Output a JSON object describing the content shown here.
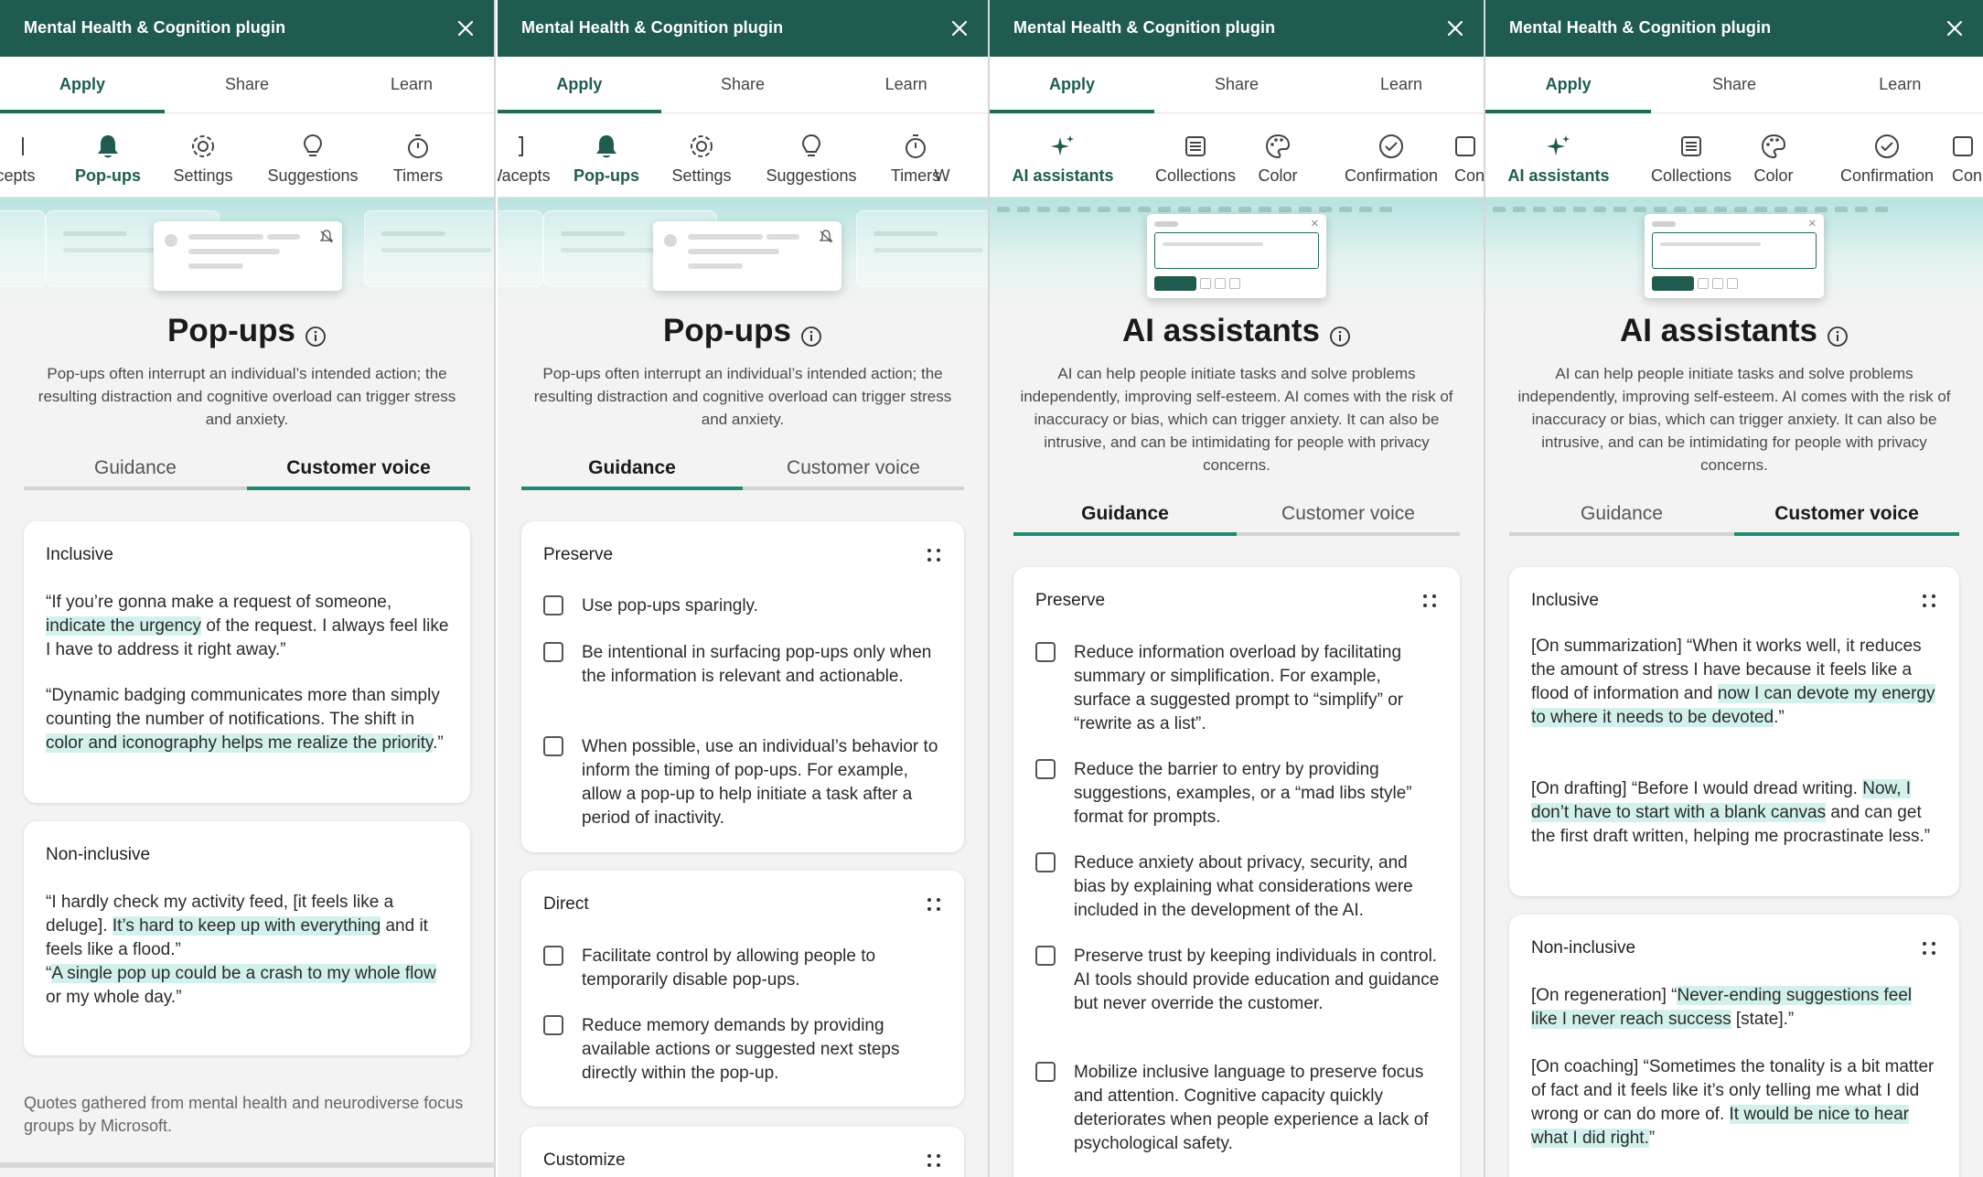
{
  "plugin_title": "Mental Health & Cognition plugin",
  "main_tabs": [
    "Apply",
    "Share",
    "Learn"
  ],
  "categories": {
    "p0": [
      "cepts",
      "Pop-ups",
      "Settings",
      "Suggestions",
      "Timers"
    ],
    "p1": [
      "Wacepts",
      "Pop-ups",
      "Settings",
      "Suggestions",
      "Timers",
      "W"
    ],
    "p2": [
      "AI assistants",
      "Collections",
      "Color",
      "Confirmation",
      "Con"
    ],
    "p3": [
      "AI assistants",
      "Collections",
      "Color",
      "Confirmation",
      "Con"
    ]
  },
  "popups": {
    "title": "Pop-ups",
    "description": "Pop-ups often interrupt an individual’s intended action; the resulting distraction and cognitive overload can trigger stress and anxiety."
  },
  "ai": {
    "title": "AI assistants",
    "description": "AI can help people initiate tasks and solve problems independently, improving self-esteem. AI comes with the risk of inaccuracy or bias, which can trigger anxiety. It can also be intrusive, and can be intimidating for people with privacy concerns."
  },
  "subtabs": [
    "Guidance",
    "Customer voice"
  ],
  "p0_voice": {
    "inclusive_title": "Inclusive",
    "non_inclusive_title": "Non-inclusive",
    "q1": [
      "“If you’re gonna make a request of someone, ",
      "indicate the urgency",
      " of the request. I always feel like I have to address it right away.”"
    ],
    "q2": [
      "“Dynamic badging communicates more than simply counting the number of notifications. The shift in ",
      "color and iconography helps me realize the priority",
      ".”"
    ],
    "q3": [
      "“I hardly check my activity feed, [it feels like a deluge]. ",
      "It’s hard to keep up with everything",
      " and it feels like a flood.”"
    ],
    "q4": [
      "“",
      "A single pop up could be a crash to my whole flow",
      " or my whole day.”"
    ],
    "footnote": "Quotes gathered from mental health and neurodiverse focus groups by Microsoft."
  },
  "p1_guidance": {
    "preserve_title": "Preserve",
    "preserve_items": [
      "Use pop-ups sparingly.",
      "Be intentional in surfacing pop-ups only when the information is relevant and actionable.",
      "When possible, use an individual’s behavior to inform the timing of pop-ups. For example, allow a pop-up to help initiate a task after a period of inactivity."
    ],
    "direct_title": "Direct",
    "direct_items": [
      "Facilitate control by allowing people to temporarily disable pop-ups.",
      "Reduce memory demands by providing available actions or suggested next steps directly within the pop-up."
    ],
    "customize_title": "Customize"
  },
  "p2_guidance": {
    "preserve_title": "Preserve",
    "items": [
      "Reduce information overload by facilitating summary or simplification. For example, surface a suggested prompt to “simplify” or “rewrite as a list”.",
      "Reduce the barrier to entry by providing suggestions, examples, or a “mad libs style” format for prompts.",
      "Reduce anxiety about privacy, security, and bias by explaining what considerations were included in the development of the AI.",
      "Preserve trust by keeping individuals in control. AI tools should provide education and guidance but never override the customer.",
      "Mobilize inclusive language to preserve focus and attention. Cognitive capacity quickly deteriorates when people experience a lack of psychological safety."
    ]
  },
  "p3_voice": {
    "inclusive_title": "Inclusive",
    "non_inclusive_title": "Non-inclusive",
    "q1": [
      "[On summarization] “When it works well, it reduces the amount of stress I have because it feels like a flood of information and ",
      "now I can devote my energy to where it needs to be devoted",
      ".”"
    ],
    "q2": [
      "[On drafting] “Before I would dread writing. ",
      "Now, I don’t have to start with a blank canvas",
      " and can get the first draft written, helping me procrastinate less.”"
    ],
    "q3": [
      "[On regeneration] “",
      "Never-ending suggestions feel like I never reach success",
      " [state].”"
    ],
    "q4": [
      "[On coaching] “Sometimes the tonality is a bit matter of fact and it feels like it’s only telling me what I did wrong or can do more of. ",
      "It would be nice to hear what I did right.",
      "”"
    ]
  },
  "colors": {
    "brand": "#1f5c4f",
    "accent": "#1f8a72",
    "highlight": "#d2f1ec"
  },
  "icons": [
    "close-icon",
    "bell-icon",
    "gear-icon",
    "lightbulb-icon",
    "timer-icon",
    "sparkle-icon",
    "collections-icon",
    "palette-icon",
    "check-circle-icon",
    "info-icon",
    "grip-icon",
    "checkbox-icon"
  ]
}
